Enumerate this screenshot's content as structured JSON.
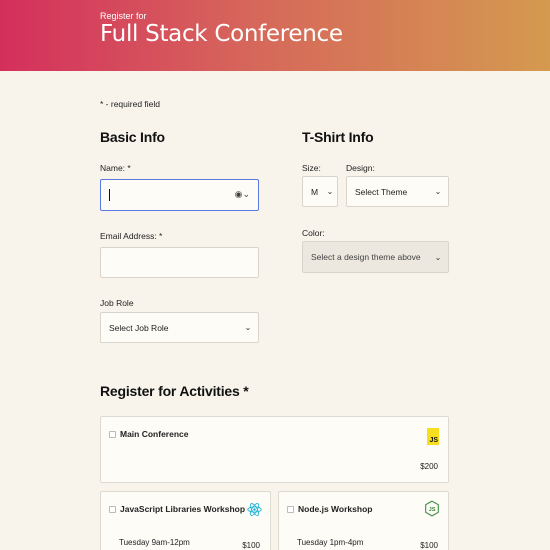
{
  "header": {
    "subtitle": "Register for",
    "title": "Full Stack Conference"
  },
  "required_note": "* - required field",
  "basic_info": {
    "heading": "Basic Info",
    "name_label": "Name: *",
    "name_value": "",
    "email_label": "Email Address: *",
    "email_value": "",
    "job_role_label": "Job Role",
    "job_role_value": "Select Job Role"
  },
  "tshirt": {
    "heading": "T-Shirt Info",
    "size_label": "Size:",
    "size_value": "M",
    "design_label": "Design:",
    "design_value": "Select Theme",
    "color_label": "Color:",
    "color_value": "Select a design theme above"
  },
  "activities": {
    "heading": "Register for Activities *",
    "items": [
      {
        "name": "Main Conference",
        "time": "",
        "cost": "$200",
        "icon": "js-icon"
      },
      {
        "name": "JavaScript Libraries Workshop",
        "time": "Tuesday 9am-12pm",
        "cost": "$100",
        "icon": "react-icon"
      },
      {
        "name": "Node.js Workshop",
        "time": "Tuesday 1pm-4pm",
        "cost": "$100",
        "icon": "nodejs-icon"
      }
    ]
  },
  "colors": {
    "header_start": "#d42f5c",
    "header_end": "#d49a4f",
    "focus_border": "#5b78e0",
    "page_bg": "#f8f4ec"
  }
}
